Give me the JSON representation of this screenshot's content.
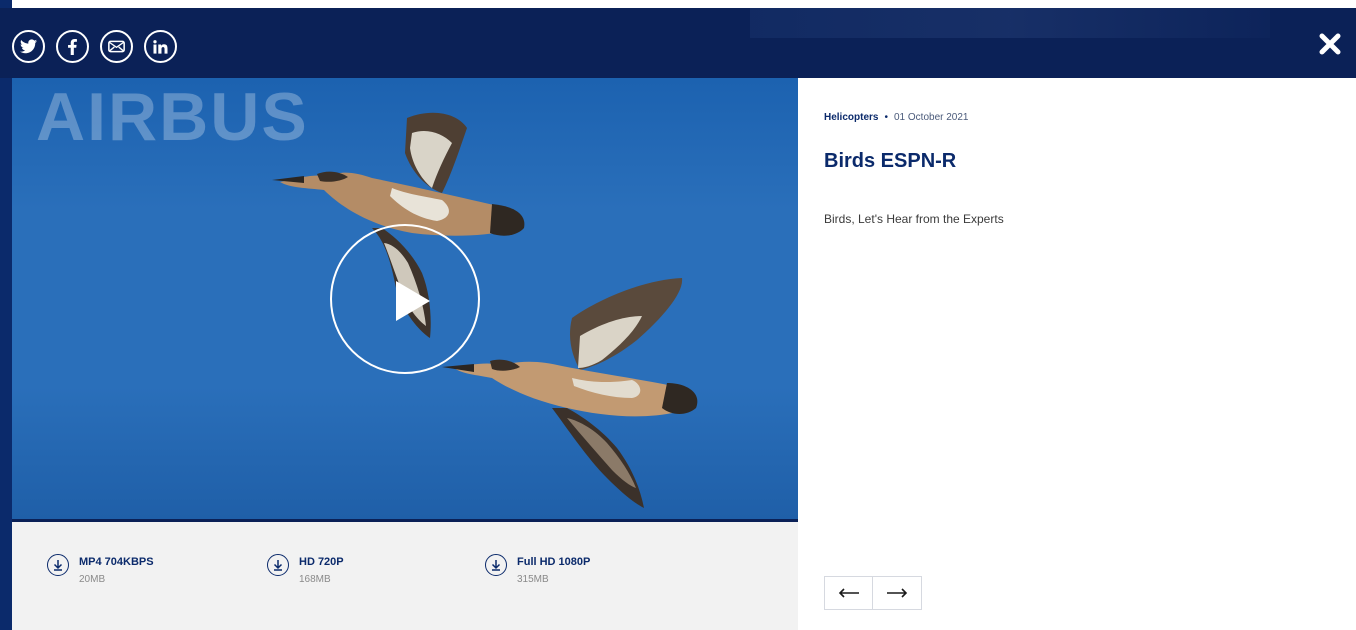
{
  "share": {
    "items": [
      {
        "name": "twitter-icon"
      },
      {
        "name": "facebook-icon"
      },
      {
        "name": "email-icon"
      },
      {
        "name": "linkedin-icon"
      }
    ]
  },
  "media": {
    "watermark": "AIRBUS",
    "play_icon": "play-icon"
  },
  "downloads": [
    {
      "label": "MP4 704KBPS",
      "size": "20MB"
    },
    {
      "label": "HD 720P",
      "size": "168MB"
    },
    {
      "label": "Full HD 1080P",
      "size": "315MB"
    }
  ],
  "info": {
    "category": "Helicopters",
    "separator": "•",
    "date": "01 October 2021",
    "title": "Birds ESPN-R",
    "description": "Birds, Let's Hear from the Experts"
  },
  "colors": {
    "brand_navy": "#0b2157",
    "text_navy": "#0b2a6b",
    "sky_blue": "#2a6fba"
  }
}
